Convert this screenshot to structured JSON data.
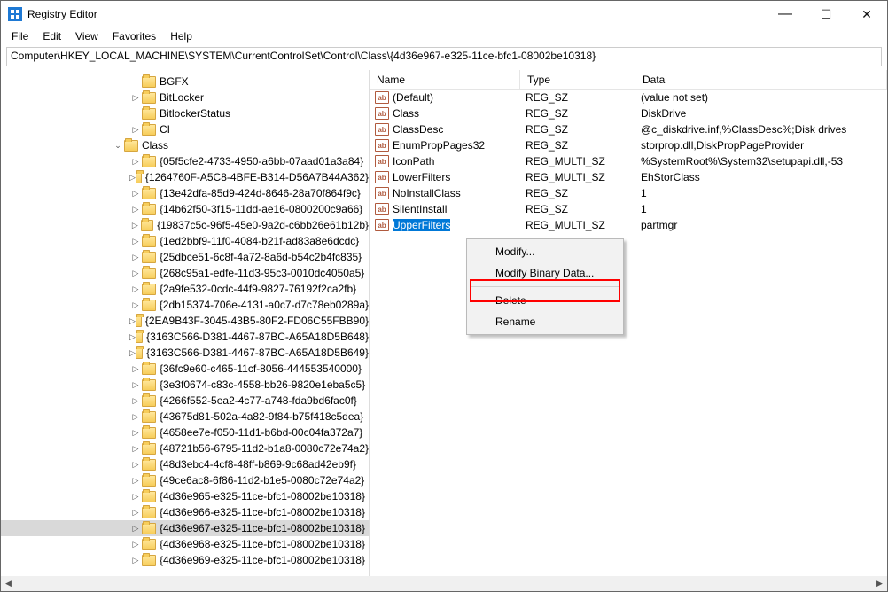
{
  "window": {
    "title": "Registry Editor"
  },
  "sysbuttons": {
    "min": "—",
    "max": "☐",
    "close": "✕"
  },
  "menus": [
    "File",
    "Edit",
    "View",
    "Favorites",
    "Help"
  ],
  "address": "Computer\\HKEY_LOCAL_MACHINE\\SYSTEM\\CurrentControlSet\\Control\\Class\\{4d36e967-e325-11ce-bfc1-08002be10318}",
  "tree": {
    "top": [
      {
        "label": "BGFX",
        "indent": 145,
        "exp": ""
      },
      {
        "label": "BitLocker",
        "indent": 145,
        "exp": "▷"
      },
      {
        "label": "BitlockerStatus",
        "indent": 145,
        "exp": ""
      },
      {
        "label": "CI",
        "indent": 145,
        "exp": "▷"
      },
      {
        "label": "Class",
        "indent": 125,
        "exp": "⌄"
      }
    ],
    "class_children": [
      "{05f5cfe2-4733-4950-a6bb-07aad01a3a84}",
      "{1264760F-A5C8-4BFE-B314-D56A7B44A362}",
      "{13e42dfa-85d9-424d-8646-28a70f864f9c}",
      "{14b62f50-3f15-11dd-ae16-0800200c9a66}",
      "{19837c5c-96f5-45e0-9a2d-c6bb26e61b12b}",
      "{1ed2bbf9-11f0-4084-b21f-ad83a8e6dcdc}",
      "{25dbce51-6c8f-4a72-8a6d-b54c2b4fc835}",
      "{268c95a1-edfe-11d3-95c3-0010dc4050a5}",
      "{2a9fe532-0cdc-44f9-9827-76192f2ca2fb}",
      "{2db15374-706e-4131-a0c7-d7c78eb0289a}",
      "{2EA9B43F-3045-43B5-80F2-FD06C55FBB90}",
      "{3163C566-D381-4467-87BC-A65A18D5B648}",
      "{3163C566-D381-4467-87BC-A65A18D5B649}",
      "{36fc9e60-c465-11cf-8056-444553540000}",
      "{3e3f0674-c83c-4558-bb26-9820e1eba5c5}",
      "{4266f552-5ea2-4c77-a748-fda9bd6fac0f}",
      "{43675d81-502a-4a82-9f84-b75f418c5dea}",
      "{4658ee7e-f050-11d1-b6bd-00c04fa372a7}",
      "{48721b56-6795-11d2-b1a8-0080c72e74a2}",
      "{48d3ebc4-4cf8-48ff-b869-9c68ad42eb9f}",
      "{49ce6ac8-6f86-11d2-b1e5-0080c72e74a2}",
      "{4d36e965-e325-11ce-bfc1-08002be10318}",
      "{4d36e966-e325-11ce-bfc1-08002be10318}",
      "{4d36e967-e325-11ce-bfc1-08002be10318}",
      "{4d36e968-e325-11ce-bfc1-08002be10318}",
      "{4d36e969-e325-11ce-bfc1-08002be10318}"
    ],
    "selected_index": 23
  },
  "columns": {
    "name": "Name",
    "type": "Type",
    "data": "Data"
  },
  "values": [
    {
      "name": "(Default)",
      "type": "REG_SZ",
      "data": "(value not set)"
    },
    {
      "name": "Class",
      "type": "REG_SZ",
      "data": "DiskDrive"
    },
    {
      "name": "ClassDesc",
      "type": "REG_SZ",
      "data": "@c_diskdrive.inf,%ClassDesc%;Disk drives"
    },
    {
      "name": "EnumPropPages32",
      "type": "REG_SZ",
      "data": "storprop.dll,DiskPropPageProvider"
    },
    {
      "name": "IconPath",
      "type": "REG_MULTI_SZ",
      "data": "%SystemRoot%\\System32\\setupapi.dll,-53"
    },
    {
      "name": "LowerFilters",
      "type": "REG_MULTI_SZ",
      "data": "EhStorClass"
    },
    {
      "name": "NoInstallClass",
      "type": "REG_SZ",
      "data": "1"
    },
    {
      "name": "SilentInstall",
      "type": "REG_SZ",
      "data": "1"
    },
    {
      "name": "UpperFilters",
      "type": "REG_MULTI_SZ",
      "data": "partmgr",
      "selected": true
    }
  ],
  "context_menu": {
    "items1": [
      "Modify...",
      "Modify Binary Data..."
    ],
    "items2": [
      "Delete",
      "Rename"
    ]
  }
}
